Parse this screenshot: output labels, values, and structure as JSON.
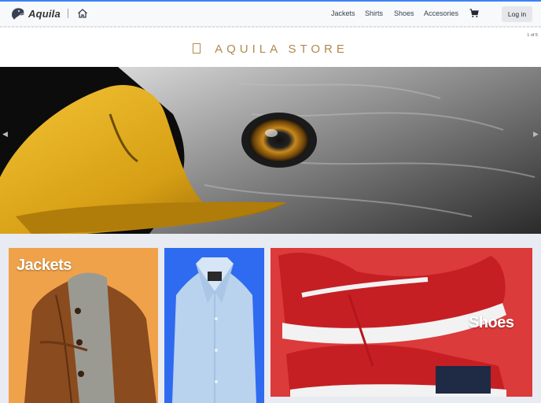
{
  "brand": {
    "name": "Aquila",
    "logo_icon": "eagle-icon",
    "accent": "#3b82f6"
  },
  "nav": {
    "home_icon": "home-icon",
    "links": [
      "Jackets",
      "Shirts",
      "Shoes",
      "Accesories"
    ],
    "cart_icon": "cart-icon",
    "login_label": "Log in"
  },
  "banner": {
    "title": "AQUILA STORE",
    "title_color": "#b08a4e",
    "page_indicator": "1 of 5",
    "prev_icon": "chevron-left-icon",
    "next_icon": "chevron-right-icon"
  },
  "categories": [
    {
      "label": "Jackets",
      "bg": "#f0a24a"
    },
    {
      "label": "",
      "bg": "#2f6bf0"
    },
    {
      "label": "Shoes",
      "bg": "#dc3b3b"
    }
  ]
}
